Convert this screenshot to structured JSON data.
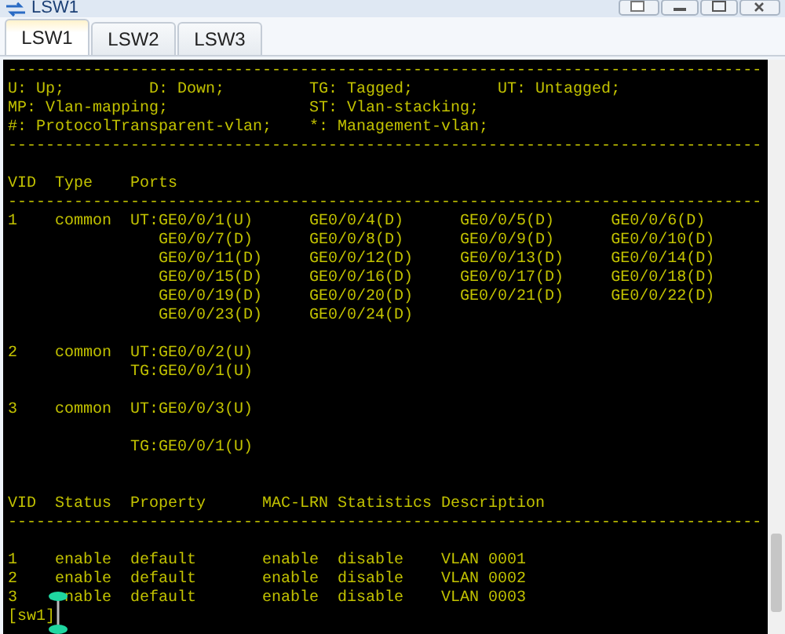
{
  "window": {
    "title": "LSW1"
  },
  "tabs": [
    {
      "label": "LSW1",
      "selected": true
    },
    {
      "label": "LSW2",
      "selected": false
    },
    {
      "label": "LSW3",
      "selected": false
    }
  ],
  "terminal": {
    "lines": [
      {
        "kind": "text",
        "text": "--------------------------------------------------------------------------------"
      },
      {
        "kind": "text",
        "text": "U: Up;         D: Down;         TG: Tagged;         UT: Untagged;"
      },
      {
        "kind": "text",
        "text": "MP: Vlan-mapping;               ST: Vlan-stacking;"
      },
      {
        "kind": "text",
        "text": "#: ProtocolTransparent-vlan;    *: Management-vlan;"
      },
      {
        "kind": "text",
        "text": "--------------------------------------------------------------------------------"
      },
      {
        "kind": "blank"
      },
      {
        "kind": "text",
        "text": "VID  Type    Ports"
      },
      {
        "kind": "text",
        "text": "--------------------------------------------------------------------------------"
      },
      {
        "kind": "text",
        "text": "1    common  UT:GE0/0/1(U)      GE0/0/4(D)      GE0/0/5(D)      GE0/0/6(D)"
      },
      {
        "kind": "text",
        "text": "                GE0/0/7(D)      GE0/0/8(D)      GE0/0/9(D)      GE0/0/10(D)"
      },
      {
        "kind": "text",
        "text": "                GE0/0/11(D)     GE0/0/12(D)     GE0/0/13(D)     GE0/0/14(D)"
      },
      {
        "kind": "text",
        "text": "                GE0/0/15(D)     GE0/0/16(D)     GE0/0/17(D)     GE0/0/18(D)"
      },
      {
        "kind": "text",
        "text": "                GE0/0/19(D)     GE0/0/20(D)     GE0/0/21(D)     GE0/0/22(D)"
      },
      {
        "kind": "text",
        "text": "                GE0/0/23(D)     GE0/0/24(D)"
      },
      {
        "kind": "blank"
      },
      {
        "kind": "text",
        "text": "2    common  UT:GE0/0/2(U)"
      },
      {
        "kind": "text",
        "text": "             TG:GE0/0/1(U)"
      },
      {
        "kind": "blank"
      },
      {
        "kind": "text",
        "text": "3    common  UT:GE0/0/3(U)"
      },
      {
        "kind": "blank"
      },
      {
        "kind": "text",
        "text": "             TG:GE0/0/1(U)"
      },
      {
        "kind": "blank"
      },
      {
        "kind": "blank"
      },
      {
        "kind": "text",
        "text": "VID  Status  Property      MAC-LRN Statistics Description"
      },
      {
        "kind": "text",
        "text": "--------------------------------------------------------------------------------"
      },
      {
        "kind": "blank"
      },
      {
        "kind": "text",
        "text": "1    enable  default       enable  disable    VLAN 0001"
      },
      {
        "kind": "text",
        "text": "2    enable  default       enable  disable    VLAN 0002"
      },
      {
        "kind": "text",
        "text": "3     nable  default       enable  disable    VLAN 0003"
      },
      {
        "kind": "text",
        "text": "[sw1]"
      }
    ]
  }
}
